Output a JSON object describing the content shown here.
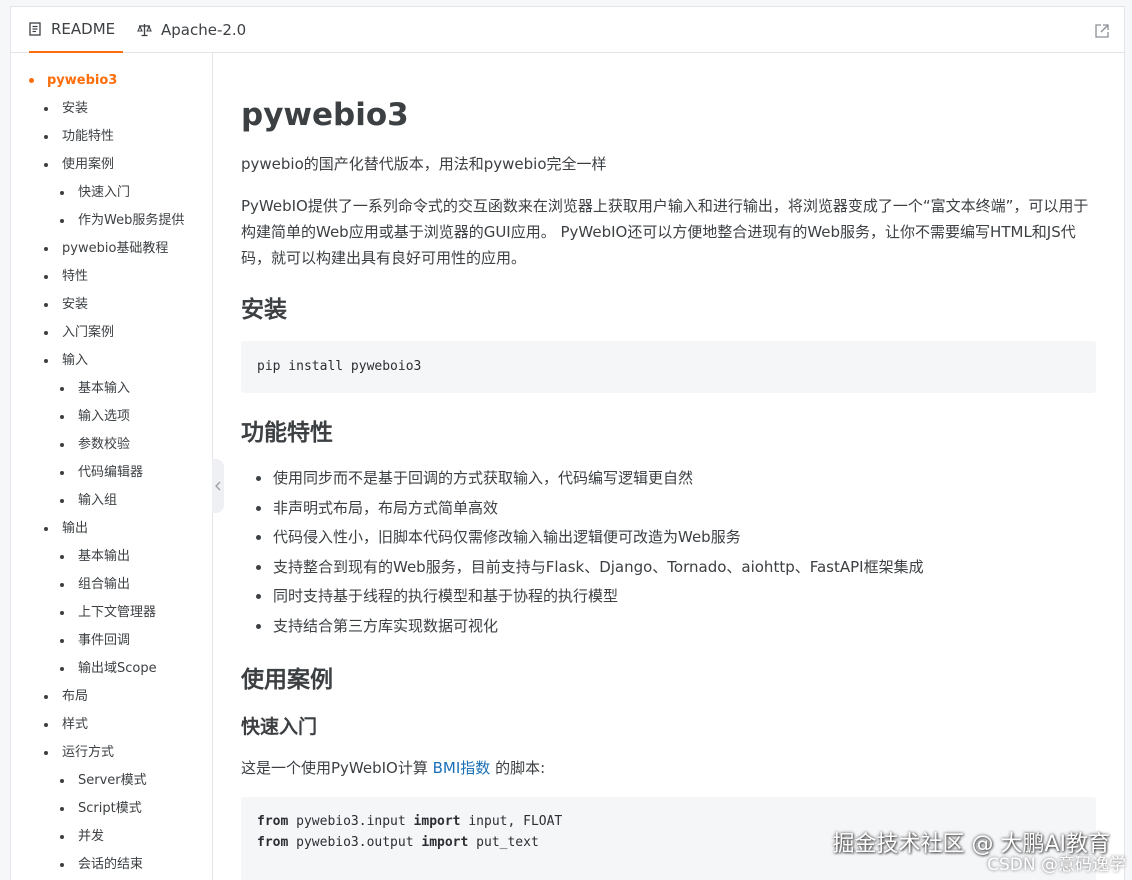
{
  "tabs": {
    "readme": "README",
    "license": "Apache-2.0"
  },
  "toc": [
    {
      "label": "pywebio3",
      "level": 0,
      "active": true
    },
    {
      "label": "安装",
      "level": 1
    },
    {
      "label": "功能特性",
      "level": 1
    },
    {
      "label": "使用案例",
      "level": 1
    },
    {
      "label": "快速入门",
      "level": 2
    },
    {
      "label": "作为Web服务提供",
      "level": 2
    },
    {
      "label": "pywebio基础教程",
      "level": 1
    },
    {
      "label": "特性",
      "level": 1
    },
    {
      "label": "安装",
      "level": 1
    },
    {
      "label": "入门案例",
      "level": 1
    },
    {
      "label": "输入",
      "level": 1
    },
    {
      "label": "基本输入",
      "level": 2
    },
    {
      "label": "输入选项",
      "level": 2
    },
    {
      "label": "参数校验",
      "level": 2
    },
    {
      "label": "代码编辑器",
      "level": 2
    },
    {
      "label": "输入组",
      "level": 2
    },
    {
      "label": "输出",
      "level": 1
    },
    {
      "label": "基本输出",
      "level": 2
    },
    {
      "label": "组合输出",
      "level": 2
    },
    {
      "label": "上下文管理器",
      "level": 2
    },
    {
      "label": "事件回调",
      "level": 2
    },
    {
      "label": "输出域Scope",
      "level": 2
    },
    {
      "label": "布局",
      "level": 1
    },
    {
      "label": "样式",
      "level": 1
    },
    {
      "label": "运行方式",
      "level": 1
    },
    {
      "label": "Server模式",
      "level": 2
    },
    {
      "label": "Script模式",
      "level": 2
    },
    {
      "label": "并发",
      "level": 2
    },
    {
      "label": "会话的结束",
      "level": 2
    }
  ],
  "content": {
    "title": "pywebio3",
    "subtitle": "pywebio的国产化替代版本，用法和pywebio完全一样",
    "intro": "PyWebIO提供了一系列命令式的交互函数来在浏览器上获取用户输入和进行输出，将浏览器变成了一个“富文本终端”，可以用于构建简单的Web应用或基于浏览器的GUI应用。 PyWebIO还可以方便地整合进现有的Web服务，让你不需要编写HTML和JS代码，就可以构建出具有良好可用性的应用。",
    "install_heading": "安装",
    "install_code": "pip install pyweboio3",
    "features_heading": "功能特性",
    "features": [
      "使用同步而不是基于回调的方式获取输入，代码编写逻辑更自然",
      "非声明式布局，布局方式简单高效",
      "代码侵入性小，旧脚本代码仅需修改输入输出逻辑便可改造为Web服务",
      "支持整合到现有的Web服务，目前支持与Flask、Django、Tornado、aiohttp、FastAPI框架集成",
      "同时支持基于线程的执行模型和基于协程的执行模型",
      "支持结合第三方库实现数据可视化"
    ],
    "cases_heading": "使用案例",
    "quickstart_heading": "快速入门",
    "bmi_prefix": "这是一个使用PyWebIO计算 ",
    "bmi_link": "BMI指数",
    "bmi_suffix": " 的脚本:",
    "code_lines": [
      {
        "kw1": "from",
        "mod": " pywebio3.input ",
        "kw2": "import",
        "names": " input, FLOAT"
      },
      {
        "kw1": "from",
        "mod": " pywebio3.output ",
        "kw2": "import",
        "names": " put_text"
      }
    ]
  },
  "watermark": {
    "main": "掘金技术社区 @ 大鹏AI教育",
    "sub": "CSDN @意码逸学"
  },
  "colors": {
    "accent": "#fd6d0c",
    "link": "#1a6fb6",
    "code_bg": "#f5f6f8"
  }
}
